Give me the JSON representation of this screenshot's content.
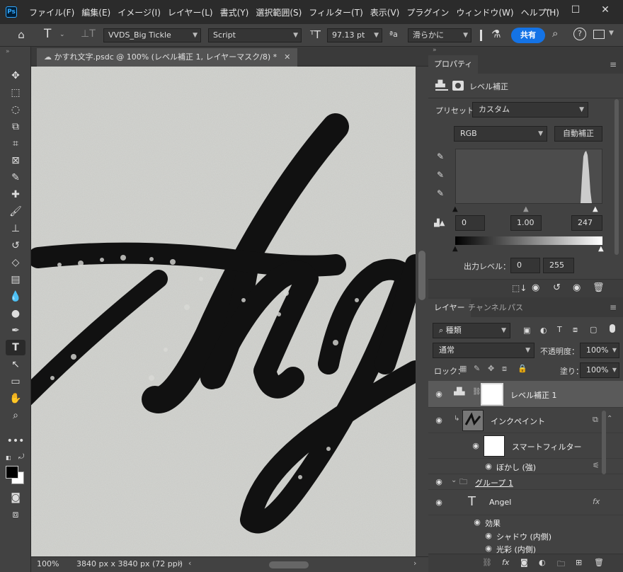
{
  "app": {
    "logo": "Ps"
  },
  "menu": [
    "ファイル(F)",
    "編集(E)",
    "イメージ(I)",
    "レイヤー(L)",
    "書式(Y)",
    "選択範囲(S)",
    "フィルター(T)",
    "表示(V)",
    "プラグイン",
    "ウィンドウ(W)",
    "ヘルプ(H)"
  ],
  "options": {
    "font_family": "VVDS_Big Tickle",
    "font_style": "Script",
    "font_size": "97.13 pt",
    "aa_label": "ªa",
    "antialias": "滑らかに",
    "share": "共有"
  },
  "doc": {
    "tab_title": "かすれ文字.psdc @ 100% (レベル補正 1, レイヤーマスク/8) *"
  },
  "status": {
    "zoom": "100%",
    "size": "3840 px x 3840 px (72 ppi)"
  },
  "properties": {
    "tab": "プロパティ",
    "title": "レベル補正",
    "preset_label": "プリセット：",
    "preset": "カスタム",
    "channel": "RGB",
    "auto": "自動補正",
    "input_black": "0",
    "input_gamma": "1.00",
    "input_white": "247",
    "output_label": "出力レベル：",
    "output_black": "0",
    "output_white": "255"
  },
  "layers_panel": {
    "tabs": [
      "レイヤー",
      "チャンネル",
      "パス"
    ],
    "filter_kind": "種類",
    "blend": "通常",
    "opacity_label": "不透明度：",
    "opacity": "100%",
    "lock_label": "ロック：",
    "fill_label": "塗り：",
    "fill": "100%"
  },
  "layers": {
    "levels": "レベル補正 1",
    "inkpaint": "インクペイント",
    "smart_filter": "スマートフィルター",
    "blur": "ぼかし (強)",
    "group": "グループ 1",
    "text": "Angel",
    "effects": "効果",
    "inner_shadow": "シャドウ (内側)",
    "outer_glow": "光彩 (内側)",
    "fx": "fx"
  },
  "colors": {
    "accent": "#1473e6",
    "panel": "#424242",
    "canvas": "#c9cac6",
    "ink": "#111111"
  }
}
